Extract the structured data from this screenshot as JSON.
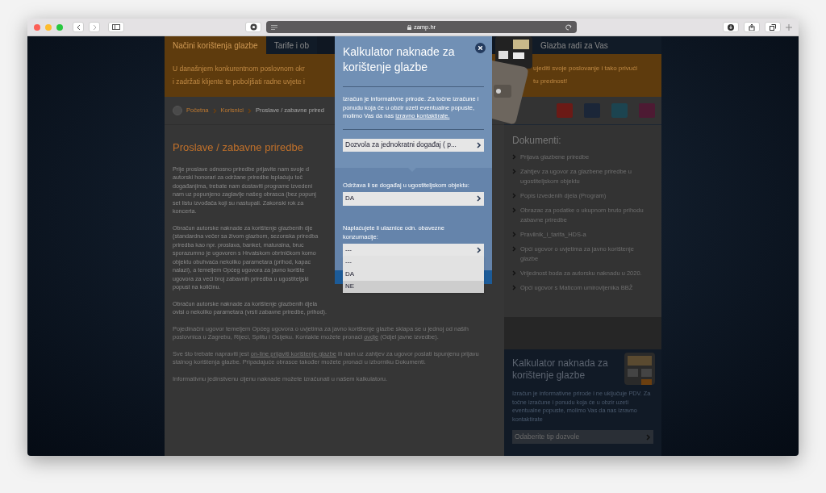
{
  "browser": {
    "url": "zamp.hr"
  },
  "nav": {
    "tabs": [
      {
        "label": "Načini korištenja glazbe",
        "selected": true
      },
      {
        "label": "Tarife i ob",
        "selected": false
      },
      {
        "label": "Glazba radi za Vas",
        "selected": false
      }
    ]
  },
  "banner": {
    "left_lines": [
      "U današnjem konkurentnom poslovnom okr",
      "i zadržati klijente te poboljšati radne uvjete i"
    ],
    "right_lines": [
      "ujediti svoje poslovanje i tako privući",
      "tu prednost!"
    ]
  },
  "breadcrumb": [
    "Početna",
    "Korisnici",
    "Proslave / zabavne prired"
  ],
  "article": {
    "title": "Proslave / zabavne priredbe",
    "cut_paragraphs": [
      [
        "Prije proslave odnosno priredbe prijavite nam svoje d",
        "autorski honorari za održane priredbe isplaćuju toč",
        "događanjima, trebate nam dostaviti programe izvedeni",
        "nam uz popunjeno zaglavlje našeg obrasca (bez popunj",
        "set listu izvođača koji su nastupali. Zakonski rok za",
        "koncerta."
      ],
      [
        "Obračun autorske naknade za korištenje glazbenih dje",
        "(standardna večer sa živom glazbom, sezonska priredba",
        "priredba kao npr. proslava, banket, maturalna, bruc",
        "sporazumno je ugovoren s Hrvatskom obrtničkom komo",
        "objektu obuhvaća nekoliko parametara (prihod, kapac",
        "nalazi), a temeljem Općeg ugovora za javno korište",
        "ugovora za veći broj zabavnih priredba u ugostiteljski",
        "popust na količinu."
      ],
      [
        "Obračun autorske naknade za korištenje glazbenih djela",
        "ovisi o nekoliko parametara (vrsti zabavne priredbe, prihod)."
      ]
    ],
    "paragraphs": [
      {
        "before": "Pojedinačni ugovor temeljem Općeg ugovora o uvjetima za javno korištenje glazbe sklapa se u jednoj od naših poslovnica u Zagrebu, Rijeci, Splitu i Osijeku. Kontakte možete pronaći ",
        "link": "ovdje",
        "after": " (Odjel javne izvedbe)."
      },
      {
        "before": "Sve što trebate napraviti jest ",
        "link": "on-line prijaviti korištenje glazbe",
        "after": " ili nam uz zahtjev za ugovor poslati ispunjenu prijavu stalnog korištenja glazbe. Pripadajuće obrasce također možete pronaći u izborniku Dokumenti."
      },
      {
        "before": "Informativnu jedinstvenu cijenu naknade možete izračunati u našem kalkulatoru."
      }
    ]
  },
  "sidebar": {
    "documents_title": "Dokumenti:",
    "documents": [
      "Prijava glazbene priredbe",
      "Zahtjev za ugovor za glazbene priredbe u ugostiteljskom objektu",
      "Popis izvedenih djela (Program)",
      "Obrazac za podatke o ukupnom bruto prihodu zabavne priredbe",
      "Pravilnik_i_tarifa_HDS-a",
      "Opći ugovor o uvjetima za javno korištenje glazbe",
      "Vrijednost boda za autorsku naknadu u 2020.",
      "Opći ugovor s Maticom umirovljenika BBŽ"
    ],
    "calculator": {
      "title": "Kalkulator naknada za korištenje glazbe",
      "text": "Izračun je informativne prirode i ne uključuje PDV. Za točne izračune i ponudu koja će u obzir uzeti eventualne popuste, molimo Vas da nas izravno kontaktirate",
      "select": "Odaberite tip dozvole"
    }
  },
  "modal": {
    "title": "Kalkulator naknade za korištenje glazbe",
    "intro": "Izračun je informativne prirode. Za točne izračune i ponudu koja će u obzir uzeti eventualne popuste, molimo Vas da nas ",
    "intro_link": "izravno kontaktirate.",
    "permit_select": "Dozvola za jednokratni događaj ( p...",
    "question_1": "Održava li se događaj u ugostiteljskom objektu:",
    "answer_1": "DA",
    "question_2": "Naplaćujete li ulaznice odn. obavezne konzumacije:",
    "answer_2": "---",
    "options": [
      {
        "label": "---",
        "selected": false
      },
      {
        "label": "DA",
        "selected": false
      },
      {
        "label": "NE",
        "selected": true
      }
    ]
  }
}
